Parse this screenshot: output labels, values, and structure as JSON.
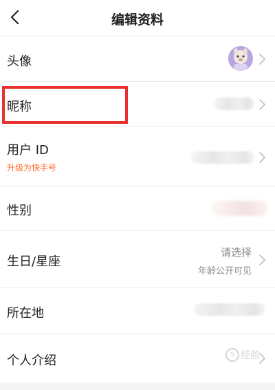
{
  "header": {
    "title": "编辑资料",
    "back_icon": "chevron-left-icon"
  },
  "rows": {
    "avatar": {
      "label": "头像"
    },
    "nickname": {
      "label": "昵称"
    },
    "user_id": {
      "label": "用户 ID",
      "upgrade": "升级为快手号"
    },
    "gender": {
      "label": "性别"
    },
    "birthday": {
      "label": "生日/星座",
      "value": "请选择",
      "note": "年龄公开可见"
    },
    "location": {
      "label": "所在地"
    },
    "intro": {
      "label": "个人介绍"
    }
  },
  "watermark": {
    "text": "经验",
    "glyph": "S"
  },
  "colors": {
    "upgrade_orange": "#ff6a2a",
    "highlight_red": "#e8312f",
    "divider": "#ececec"
  }
}
